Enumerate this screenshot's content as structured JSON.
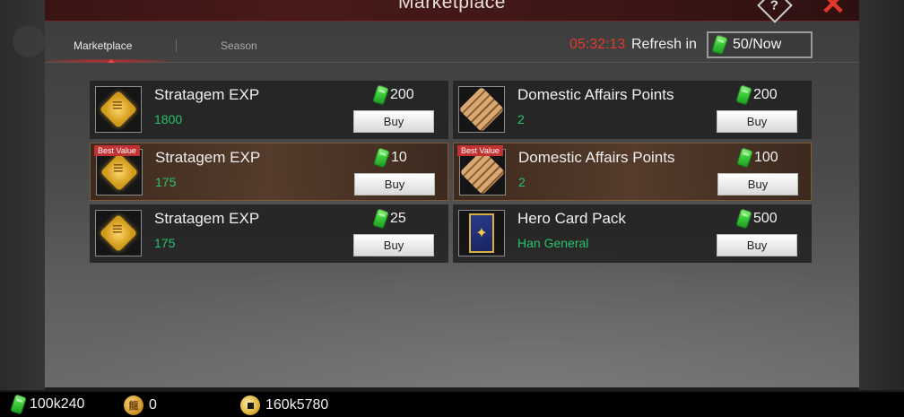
{
  "window": {
    "title": "Marketplace"
  },
  "tabs": [
    {
      "label": "Marketplace",
      "active": true
    },
    {
      "label": "Season",
      "active": false
    }
  ],
  "refresh": {
    "timer": "05:32:13",
    "label": "Refresh in",
    "button_label": "50/Now"
  },
  "items": [
    {
      "name": "Stratagem EXP",
      "qty": "1800",
      "price": "200",
      "badge": "",
      "icon": "stratagem-fist-icon",
      "buy": "Buy"
    },
    {
      "name": "Domestic Affairs Points",
      "qty": "2",
      "price": "200",
      "badge": "",
      "icon": "bamboo-scroll-icon",
      "buy": "Buy"
    },
    {
      "name": "Stratagem EXP",
      "qty": "175",
      "price": "10",
      "badge": "Best Value",
      "icon": "stratagem-fist-icon",
      "buy": "Buy"
    },
    {
      "name": "Domestic Affairs Points",
      "qty": "2",
      "price": "100",
      "badge": "Best Value",
      "icon": "bamboo-scroll-icon",
      "buy": "Buy"
    },
    {
      "name": "Stratagem EXP",
      "qty": "175",
      "price": "25",
      "badge": "",
      "icon": "stratagem-fist-icon",
      "buy": "Buy"
    },
    {
      "name": "Hero Card Pack",
      "qty": "Han General",
      "price": "500",
      "badge": "",
      "icon": "hero-card-icon",
      "buy": "Buy"
    }
  ],
  "resources": {
    "jade": "100k240",
    "coin": "0",
    "gold": "160k5780"
  },
  "colors": {
    "timer": "#e23a2c",
    "qty": "#29c26a",
    "close": "#e0382b",
    "badge": "#c23232"
  }
}
